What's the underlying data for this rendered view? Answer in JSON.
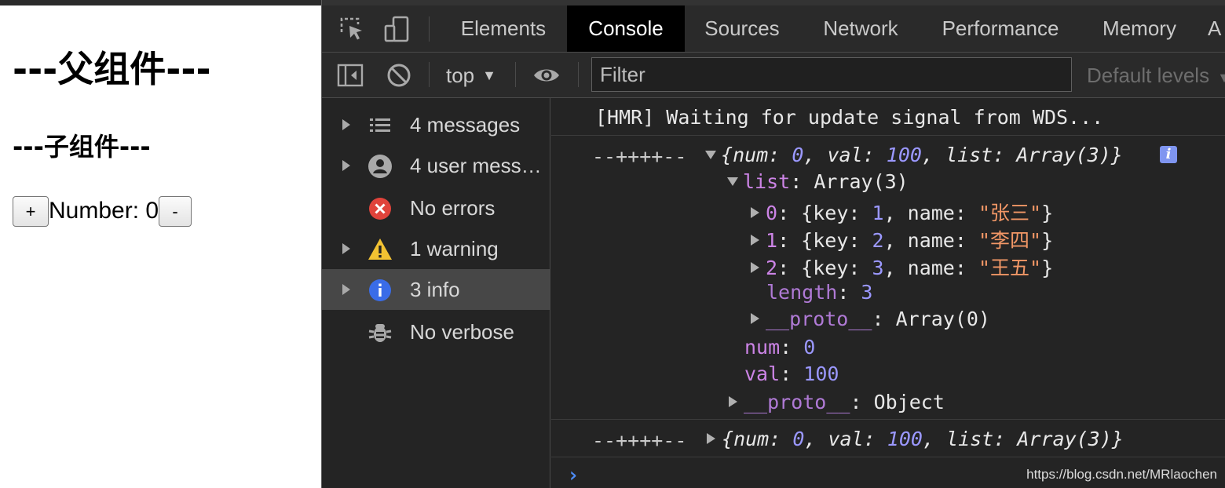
{
  "page": {
    "parent_heading": "---父组件---",
    "child_heading": "---子组件---",
    "plus_label": "+",
    "number_label": "Number: 0",
    "minus_label": "-"
  },
  "devtools": {
    "tabs": [
      "Elements",
      "Console",
      "Sources",
      "Network",
      "Performance",
      "Memory",
      "A"
    ],
    "active_tab": "Console",
    "toolbar": {
      "context": "top",
      "filter_placeholder": "Filter",
      "levels": "Default levels"
    },
    "sidebar": [
      {
        "label": "4 messages",
        "icon": "list-icon",
        "expandable": true
      },
      {
        "label": "4 user mess…",
        "icon": "user-icon",
        "expandable": true
      },
      {
        "label": "No errors",
        "icon": "error-icon",
        "expandable": false
      },
      {
        "label": "1 warning",
        "icon": "warning-icon",
        "expandable": true
      },
      {
        "label": "3 info",
        "icon": "info-icon",
        "expandable": true,
        "selected": true
      },
      {
        "label": "No verbose",
        "icon": "bug-icon",
        "expandable": false
      }
    ],
    "console": {
      "hmr_message": "[HMR] Waiting for update signal from WDS...",
      "log_prefix": "--++++--",
      "summary": {
        "open": "{",
        "k1": "num",
        "v1": "0",
        "k2": "val",
        "v2": "100",
        "k3": "list",
        "v3": "Array(3)",
        "close": "}"
      },
      "list_key": "list",
      "list_value": "Array(3)",
      "items": [
        {
          "index": "0",
          "key": "1",
          "name": "\"张三\""
        },
        {
          "index": "1",
          "key": "2",
          "name": "\"李四\""
        },
        {
          "index": "2",
          "key": "3",
          "name": "\"王五\""
        }
      ],
      "length_key": "length",
      "length_value": "3",
      "array_proto_key": "__proto__",
      "array_proto_value": "Array(0)",
      "num_key": "num",
      "num_value": "0",
      "val_key": "val",
      "val_value": "100",
      "obj_proto_key": "__proto__",
      "obj_proto_value": "Object",
      "info_badge": "i",
      "prompt": "›",
      "watermark": "https://blog.csdn.net/MRlaochen"
    }
  },
  "colors": {
    "devtools_bg": "#242424",
    "active_tab_bg": "#000000",
    "key_purple": "#cc84e6",
    "number_blue": "#9b98ff",
    "string_orange": "#f29766",
    "prompt_blue": "#4d8cf5"
  }
}
